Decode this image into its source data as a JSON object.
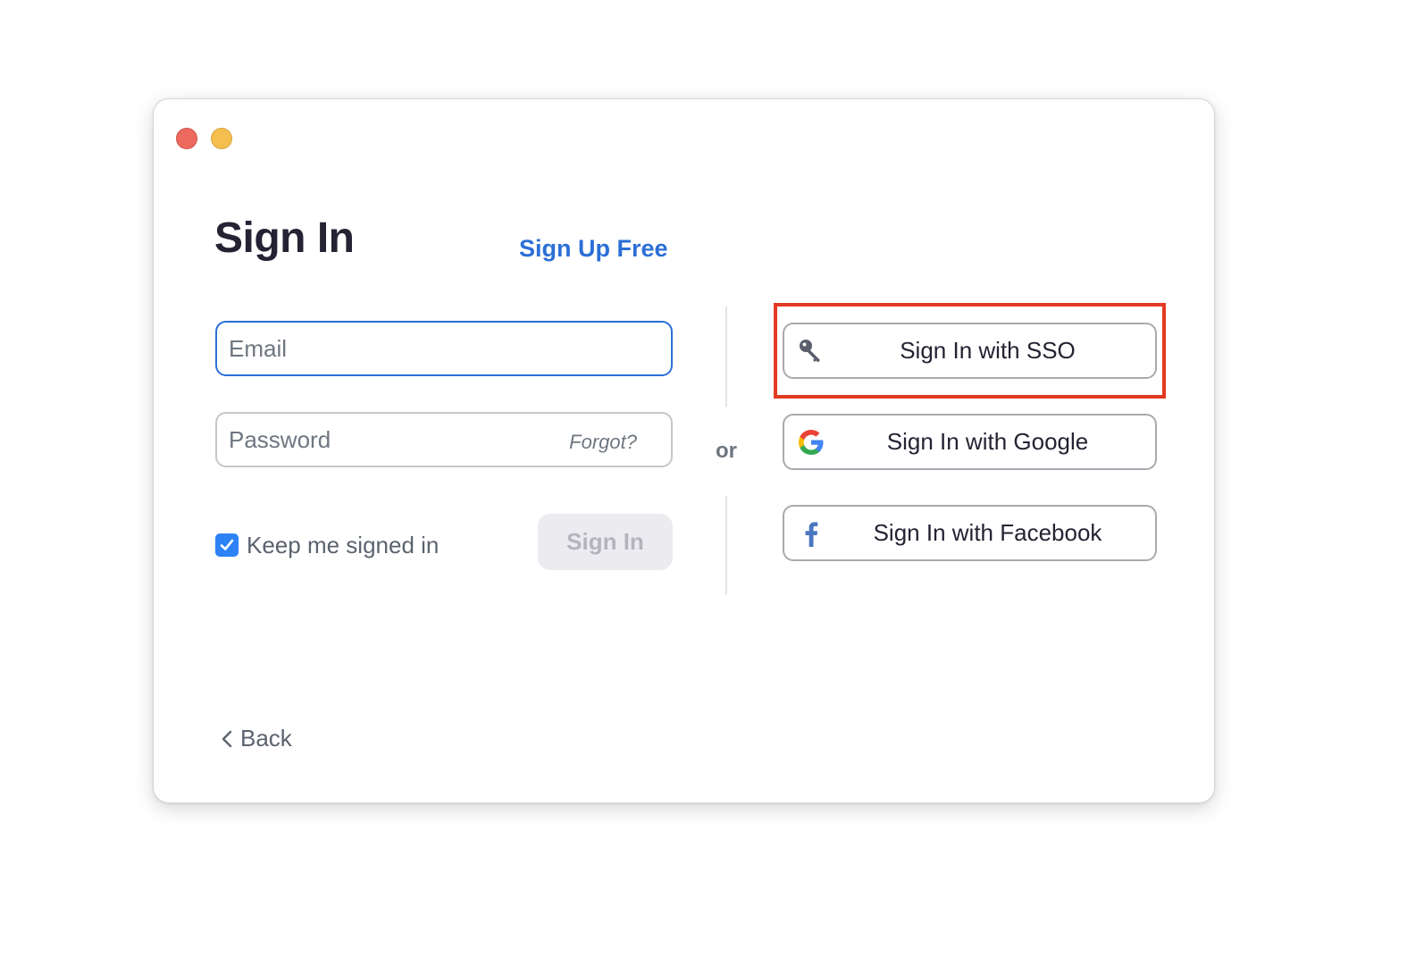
{
  "window": {
    "controls": [
      "close",
      "minimize"
    ]
  },
  "header": {
    "title": "Sign In",
    "signup_link": "Sign Up Free"
  },
  "form": {
    "email_placeholder": "Email",
    "email_value": "",
    "password_placeholder": "Password",
    "password_value": "",
    "forgot_link": "Forgot?",
    "keep_signed_in_label": "Keep me signed in",
    "keep_signed_in_checked": true,
    "signin_button": "Sign In"
  },
  "separator": {
    "or_text": "or"
  },
  "alternatives": [
    {
      "label": "Sign In with SSO",
      "icon": "key-icon"
    },
    {
      "label": "Sign In with Google",
      "icon": "google-icon"
    },
    {
      "label": "Sign In with Facebook",
      "icon": "facebook-icon"
    }
  ],
  "footer": {
    "back_label": "Back"
  },
  "colors": {
    "accent_blue": "#2b6fd6",
    "checkbox_blue": "#2d82f5",
    "highlight_red": "#e23a22",
    "close_red": "#ec6a5e",
    "minimize_yellow": "#f4bf4f"
  }
}
